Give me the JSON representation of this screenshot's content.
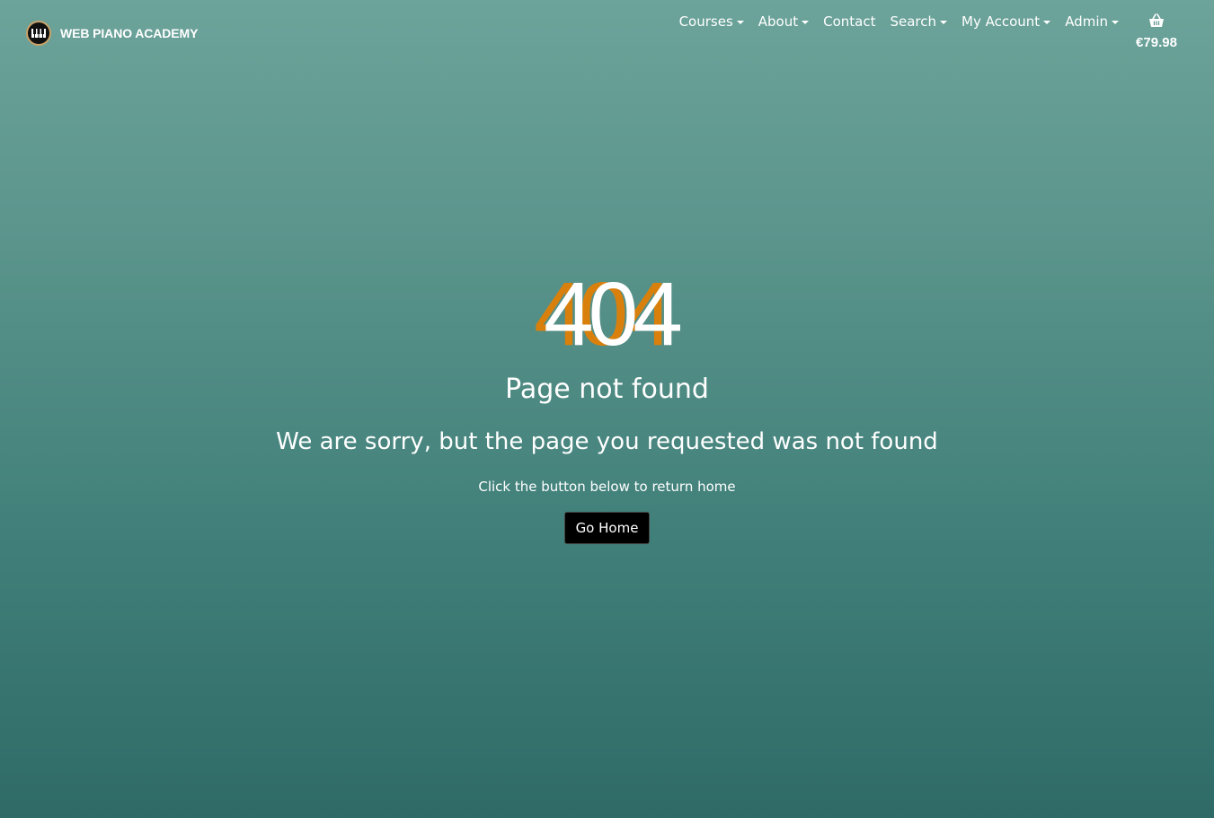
{
  "navbar": {
    "brand": "WEB PIANO ACADEMY",
    "items": [
      {
        "label": "Courses",
        "dropdown": true
      },
      {
        "label": "About",
        "dropdown": true
      },
      {
        "label": "Contact",
        "dropdown": false
      },
      {
        "label": "Search",
        "dropdown": true
      },
      {
        "label": "My Account",
        "dropdown": true
      },
      {
        "label": "Admin",
        "dropdown": true
      }
    ],
    "cart": {
      "icon": "basket-icon",
      "total": "€79.98"
    }
  },
  "error": {
    "code": "404",
    "title": "Page not found",
    "message": "We are sorry, but the page you requested was not found",
    "hint": "Click the button below to return home",
    "button_label": "Go Home"
  },
  "colors": {
    "accent": "#d9800c",
    "button_bg": "#000000",
    "gradient_top": "#6ca39a",
    "gradient_bottom": "#2f6a67"
  }
}
